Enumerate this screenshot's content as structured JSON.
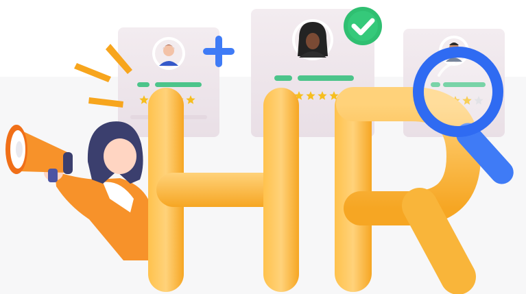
{
  "illustration": {
    "headline": "HR",
    "candidate_cards": [
      {
        "id": "left",
        "stars_filled": 5,
        "stars_total": 5,
        "badge": "plus-icon"
      },
      {
        "id": "center",
        "stars_filled": 5,
        "stars_total": 5,
        "badge": "check-icon"
      },
      {
        "id": "right",
        "stars_filled": 4,
        "stars_total": 5,
        "badge": "magnifier-icon"
      }
    ],
    "colors": {
      "letters": "#FDB53A",
      "letters_light": "#FFD27A",
      "card": "#EFE7EC",
      "rating_bar": "#4CC48A",
      "star": "#F6BE1E",
      "plus": "#3F7BF6",
      "check_badge": "#2FBF71",
      "magnifier": "#2F6BF2",
      "megaphone": "#F7922A",
      "jacket": "#F7922A",
      "hair": "#3B3F6E"
    }
  }
}
